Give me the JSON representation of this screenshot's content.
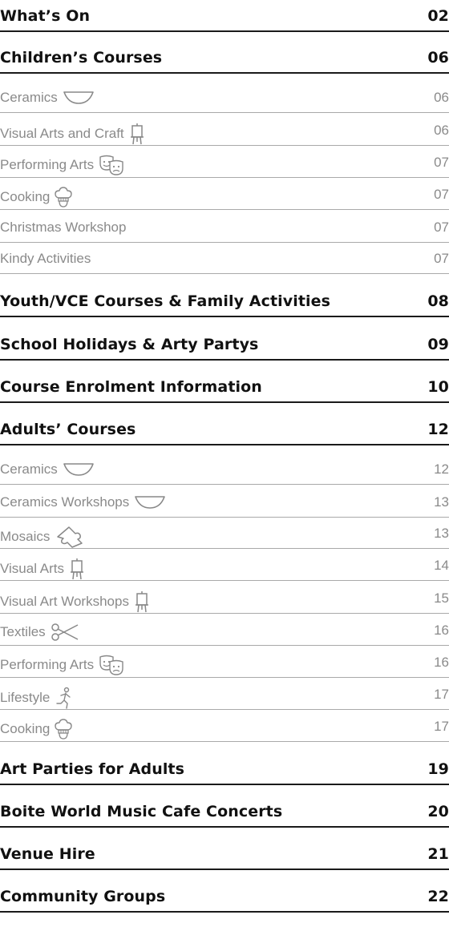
{
  "toc": [
    {
      "id": "whats-on",
      "level": "main",
      "title": "What’s On",
      "page": "02"
    },
    {
      "id": "childrens-courses",
      "level": "main",
      "title": "Children’s Courses",
      "page": "06"
    },
    {
      "id": "children-ceramics",
      "level": "sub",
      "title": "Ceramics",
      "page": "06",
      "icon": "bowl-icon"
    },
    {
      "id": "children-visual-arts-and-craft",
      "level": "sub",
      "title": "Visual Arts and Craft",
      "page": "06",
      "icon": "easel-icon"
    },
    {
      "id": "children-performing-arts",
      "level": "sub",
      "title": "Performing Arts",
      "page": "07",
      "icon": "theatre-masks-icon"
    },
    {
      "id": "children-cooking",
      "level": "sub",
      "title": "Cooking",
      "page": "07",
      "icon": "chef-hat-icon"
    },
    {
      "id": "christmas-workshop",
      "level": "sub",
      "title": "Christmas Workshop",
      "page": "07"
    },
    {
      "id": "kindy-activities",
      "level": "sub",
      "title": "Kindy Activities",
      "page": "07"
    },
    {
      "id": "youth-vce",
      "level": "main",
      "title": "Youth/VCE Courses & Family Activities",
      "page": "08"
    },
    {
      "id": "school-holidays",
      "level": "main",
      "title": "School Holidays & Arty Partys",
      "page": "09"
    },
    {
      "id": "course-enrolment",
      "level": "main",
      "title": "Course Enrolment Information",
      "page": "10"
    },
    {
      "id": "adults-courses",
      "level": "main",
      "title": "Adults’ Courses",
      "page": "12"
    },
    {
      "id": "adult-ceramics",
      "level": "sub",
      "title": "Ceramics",
      "page": "12",
      "icon": "bowl-icon"
    },
    {
      "id": "ceramics-workshops",
      "level": "sub",
      "title": "Ceramics Workshops",
      "page": "13",
      "icon": "bowl-icon"
    },
    {
      "id": "mosaics",
      "level": "sub",
      "title": "Mosaics",
      "page": "13",
      "icon": "mosaic-tile-icon"
    },
    {
      "id": "adult-visual-arts",
      "level": "sub",
      "title": "Visual Arts",
      "page": "14",
      "icon": "easel-icon"
    },
    {
      "id": "visual-art-workshops",
      "level": "sub",
      "title": "Visual Art Workshops",
      "page": "15",
      "icon": "easel-icon"
    },
    {
      "id": "textiles",
      "level": "sub",
      "title": "Textiles",
      "page": "16",
      "icon": "scissors-icon"
    },
    {
      "id": "adult-performing-arts",
      "level": "sub",
      "title": "Performing Arts",
      "page": "16",
      "icon": "theatre-masks-icon"
    },
    {
      "id": "lifestyle",
      "level": "sub",
      "title": "Lifestyle",
      "page": "17",
      "icon": "running-person-icon"
    },
    {
      "id": "adult-cooking",
      "level": "sub",
      "title": "Cooking",
      "page": "17",
      "icon": "chef-hat-icon"
    },
    {
      "id": "art-parties-adults",
      "level": "main",
      "title": "Art Parties for Adults",
      "page": "19"
    },
    {
      "id": "boite-world-music",
      "level": "main",
      "title": "Boite World Music Cafe Concerts",
      "page": "20"
    },
    {
      "id": "venue-hire",
      "level": "main",
      "title": "Venue Hire",
      "page": "21"
    },
    {
      "id": "community-groups",
      "level": "main",
      "title": "Community Groups",
      "page": "22"
    }
  ]
}
